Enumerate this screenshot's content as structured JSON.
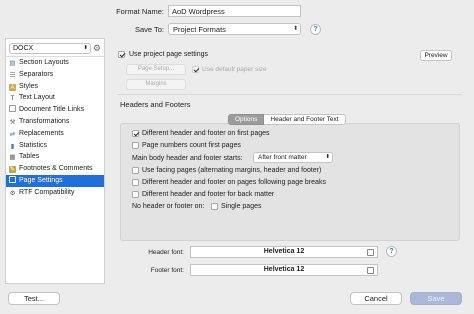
{
  "format": {
    "name_label": "Format Name:",
    "name_value": "AoD Wordpress",
    "save_to_label": "Save To:",
    "save_to_value": "Project Formats",
    "help": "?"
  },
  "sidebar": {
    "select_value": "DOCX",
    "gear_icon": "gear-icon",
    "items": [
      {
        "label": "Section Layouts",
        "icon": "section-layouts-icon",
        "color": "#5a6b8c"
      },
      {
        "label": "Separators",
        "icon": "separators-icon",
        "color": "#7a7a7a"
      },
      {
        "label": "Styles",
        "icon": "styles-icon",
        "color": "#d7a33c"
      },
      {
        "label": "Text Layout",
        "icon": "text-layout-icon",
        "color": "#444444"
      },
      {
        "label": "Document Title Links",
        "icon": "document-title-links-icon",
        "color": "#9a9a9a"
      },
      {
        "label": "Transformations",
        "icon": "transformations-icon",
        "color": "#6b6b6b"
      },
      {
        "label": "Replacements",
        "icon": "replacements-icon",
        "color": "#3d7bd9"
      },
      {
        "label": "Statistics",
        "icon": "statistics-icon",
        "color": "#3d7bd9"
      },
      {
        "label": "Tables",
        "icon": "tables-icon",
        "color": "#666666"
      },
      {
        "label": "Footnotes & Comments",
        "icon": "footnotes-comments-icon",
        "color": "#c9a23a"
      },
      {
        "label": "Page Settings",
        "icon": "page-settings-icon",
        "color": "#ffffff",
        "selected": true
      },
      {
        "label": "RTF Compatibility",
        "icon": "rtf-compatibility-icon",
        "color": "#555555"
      }
    ]
  },
  "page_settings": {
    "use_project_label": "Use project page settings",
    "use_project_checked": true,
    "preview_label": "Preview",
    "page_setup_label": "Page Setup...",
    "use_default_paper_label": "Use default paper size",
    "margins_label": "Margins"
  },
  "headers_footers": {
    "title": "Headers and Footers",
    "tabs": [
      {
        "label": "Options",
        "active": true
      },
      {
        "label": "Header and Footer Text",
        "active": false
      }
    ],
    "options": {
      "different_first": "Different header and footer on first pages",
      "page_numbers_first": "Page numbers count first pages",
      "main_body_label": "Main body header and footer starts:",
      "main_body_value": "After front matter",
      "facing_pages": "Use facing pages (alternating margins, header and footer)",
      "different_after_breaks": "Different header and footer on pages following page breaks",
      "different_back_matter": "Different header and footer for back matter",
      "no_header_label": "No header or footer on:",
      "single_pages": "Single pages"
    },
    "header_font_label": "Header font:",
    "header_font_value": "Helvetica 12",
    "footer_font_label": "Footer font:",
    "footer_font_value": "Helvetica 12",
    "help": "?"
  },
  "bottom": {
    "test_label": "Test...",
    "cancel_label": "Cancel",
    "save_label": "Save"
  }
}
